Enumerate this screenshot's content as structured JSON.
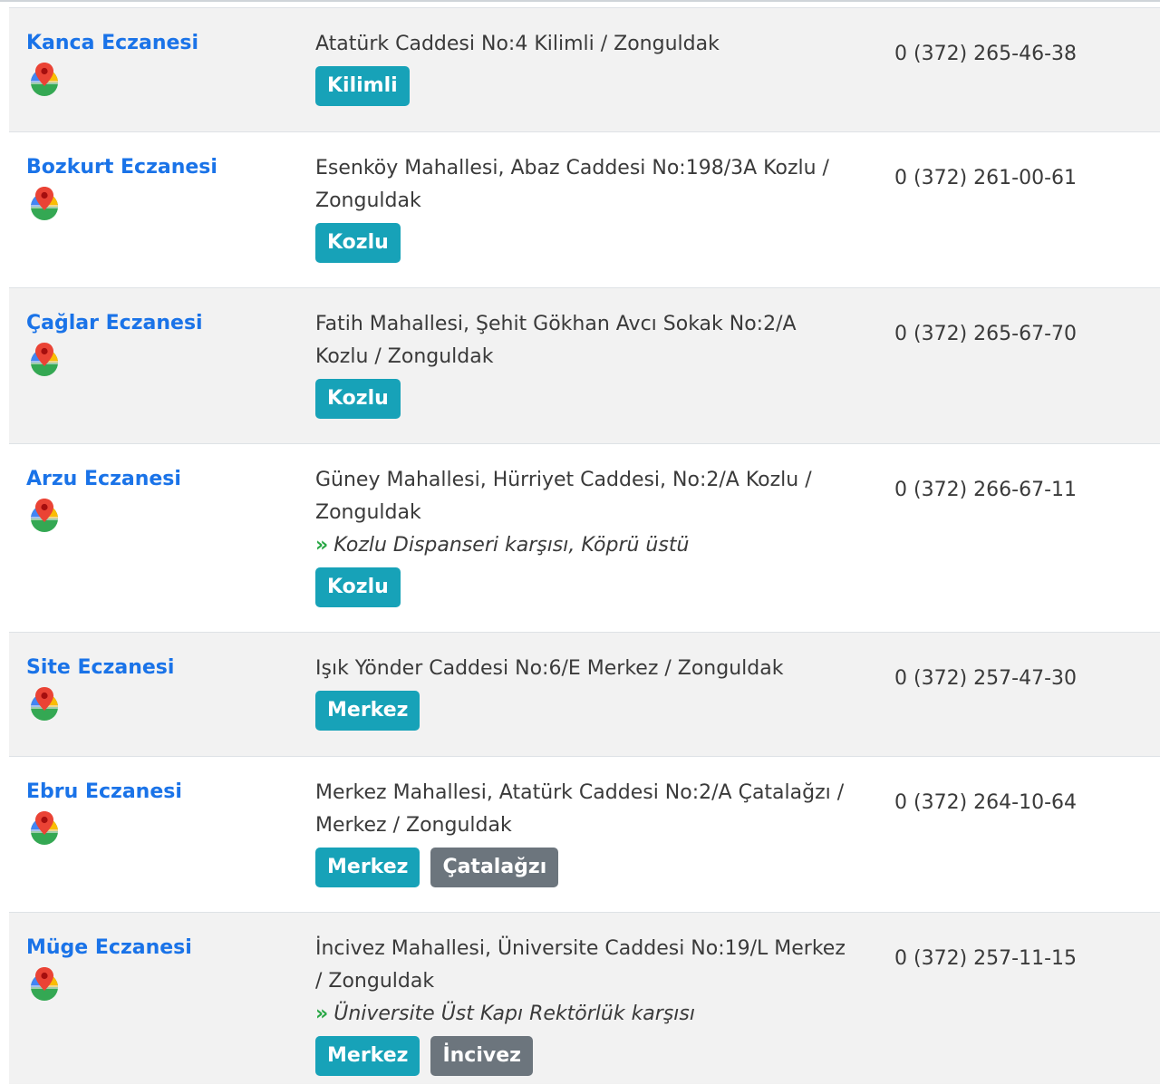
{
  "colors": {
    "link": "#1a73e8",
    "tag_primary": "#17a2b8",
    "tag_secondary": "#6c757d",
    "note_marker": "#28a745",
    "stripe": "#f2f2f2"
  },
  "icons": {
    "map": "google-maps-pin-icon"
  },
  "pharmacies": [
    {
      "name": "Kanca Eczanesi",
      "address": "Atatürk Caddesi No:4 Kilimli / Zonguldak",
      "note": "",
      "tags": [
        "Kilimli"
      ],
      "phone": "0 (372) 265-46-38"
    },
    {
      "name": "Bozkurt Eczanesi",
      "address": "Esenköy Mahallesi, Abaz Caddesi No:198/3A Kozlu / Zonguldak",
      "note": "",
      "tags": [
        "Kozlu"
      ],
      "phone": "0 (372) 261-00-61"
    },
    {
      "name": "Çağlar Eczanesi",
      "address": "Fatih Mahallesi, Şehit Gökhan Avcı Sokak No:2/A Kozlu / Zonguldak",
      "note": "",
      "tags": [
        "Kozlu"
      ],
      "phone": "0 (372) 265-67-70"
    },
    {
      "name": "Arzu Eczanesi",
      "address": "Güney Mahallesi, Hürriyet Caddesi, No:2/A Kozlu / Zonguldak",
      "note": "Kozlu Dispanseri karşısı, Köprü üstü",
      "tags": [
        "Kozlu"
      ],
      "phone": "0 (372) 266-67-11"
    },
    {
      "name": "Site Eczanesi",
      "address": "Işık Yönder Caddesi No:6/E Merkez / Zonguldak",
      "note": "",
      "tags": [
        "Merkez"
      ],
      "phone": "0 (372) 257-47-30"
    },
    {
      "name": "Ebru Eczanesi",
      "address": "Merkez Mahallesi, Atatürk Caddesi No:2/A Çatalağzı / Merkez / Zonguldak",
      "note": "",
      "tags": [
        "Merkez",
        "Çatalağzı"
      ],
      "phone": "0 (372) 264-10-64"
    },
    {
      "name": "Müge Eczanesi",
      "address": "İncivez Mahallesi, Üniversite Caddesi No:19/L Merkez / Zonguldak",
      "note": "Üniversite Üst Kapı Rektörlük karşısı",
      "tags": [
        "Merkez",
        "İncivez"
      ],
      "phone": "0 (372) 257-11-15"
    }
  ]
}
